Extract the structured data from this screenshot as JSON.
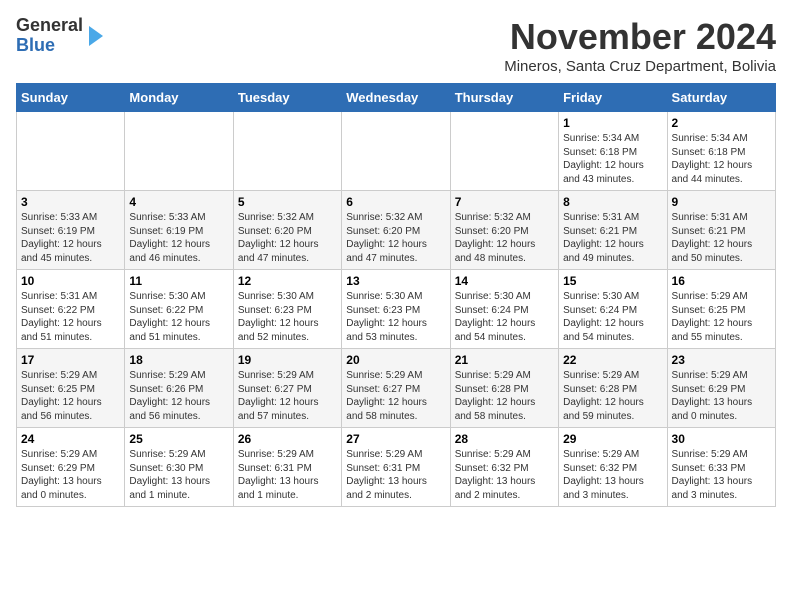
{
  "logo": {
    "general": "General",
    "blue": "Blue"
  },
  "header": {
    "title": "November 2024",
    "subtitle": "Mineros, Santa Cruz Department, Bolivia"
  },
  "days_of_week": [
    "Sunday",
    "Monday",
    "Tuesday",
    "Wednesday",
    "Thursday",
    "Friday",
    "Saturday"
  ],
  "weeks": [
    [
      {
        "day": "",
        "info": ""
      },
      {
        "day": "",
        "info": ""
      },
      {
        "day": "",
        "info": ""
      },
      {
        "day": "",
        "info": ""
      },
      {
        "day": "",
        "info": ""
      },
      {
        "day": "1",
        "info": "Sunrise: 5:34 AM\nSunset: 6:18 PM\nDaylight: 12 hours\nand 43 minutes."
      },
      {
        "day": "2",
        "info": "Sunrise: 5:34 AM\nSunset: 6:18 PM\nDaylight: 12 hours\nand 44 minutes."
      }
    ],
    [
      {
        "day": "3",
        "info": "Sunrise: 5:33 AM\nSunset: 6:19 PM\nDaylight: 12 hours\nand 45 minutes."
      },
      {
        "day": "4",
        "info": "Sunrise: 5:33 AM\nSunset: 6:19 PM\nDaylight: 12 hours\nand 46 minutes."
      },
      {
        "day": "5",
        "info": "Sunrise: 5:32 AM\nSunset: 6:20 PM\nDaylight: 12 hours\nand 47 minutes."
      },
      {
        "day": "6",
        "info": "Sunrise: 5:32 AM\nSunset: 6:20 PM\nDaylight: 12 hours\nand 47 minutes."
      },
      {
        "day": "7",
        "info": "Sunrise: 5:32 AM\nSunset: 6:20 PM\nDaylight: 12 hours\nand 48 minutes."
      },
      {
        "day": "8",
        "info": "Sunrise: 5:31 AM\nSunset: 6:21 PM\nDaylight: 12 hours\nand 49 minutes."
      },
      {
        "day": "9",
        "info": "Sunrise: 5:31 AM\nSunset: 6:21 PM\nDaylight: 12 hours\nand 50 minutes."
      }
    ],
    [
      {
        "day": "10",
        "info": "Sunrise: 5:31 AM\nSunset: 6:22 PM\nDaylight: 12 hours\nand 51 minutes."
      },
      {
        "day": "11",
        "info": "Sunrise: 5:30 AM\nSunset: 6:22 PM\nDaylight: 12 hours\nand 51 minutes."
      },
      {
        "day": "12",
        "info": "Sunrise: 5:30 AM\nSunset: 6:23 PM\nDaylight: 12 hours\nand 52 minutes."
      },
      {
        "day": "13",
        "info": "Sunrise: 5:30 AM\nSunset: 6:23 PM\nDaylight: 12 hours\nand 53 minutes."
      },
      {
        "day": "14",
        "info": "Sunrise: 5:30 AM\nSunset: 6:24 PM\nDaylight: 12 hours\nand 54 minutes."
      },
      {
        "day": "15",
        "info": "Sunrise: 5:30 AM\nSunset: 6:24 PM\nDaylight: 12 hours\nand 54 minutes."
      },
      {
        "day": "16",
        "info": "Sunrise: 5:29 AM\nSunset: 6:25 PM\nDaylight: 12 hours\nand 55 minutes."
      }
    ],
    [
      {
        "day": "17",
        "info": "Sunrise: 5:29 AM\nSunset: 6:25 PM\nDaylight: 12 hours\nand 56 minutes."
      },
      {
        "day": "18",
        "info": "Sunrise: 5:29 AM\nSunset: 6:26 PM\nDaylight: 12 hours\nand 56 minutes."
      },
      {
        "day": "19",
        "info": "Sunrise: 5:29 AM\nSunset: 6:27 PM\nDaylight: 12 hours\nand 57 minutes."
      },
      {
        "day": "20",
        "info": "Sunrise: 5:29 AM\nSunset: 6:27 PM\nDaylight: 12 hours\nand 58 minutes."
      },
      {
        "day": "21",
        "info": "Sunrise: 5:29 AM\nSunset: 6:28 PM\nDaylight: 12 hours\nand 58 minutes."
      },
      {
        "day": "22",
        "info": "Sunrise: 5:29 AM\nSunset: 6:28 PM\nDaylight: 12 hours\nand 59 minutes."
      },
      {
        "day": "23",
        "info": "Sunrise: 5:29 AM\nSunset: 6:29 PM\nDaylight: 13 hours\nand 0 minutes."
      }
    ],
    [
      {
        "day": "24",
        "info": "Sunrise: 5:29 AM\nSunset: 6:29 PM\nDaylight: 13 hours\nand 0 minutes."
      },
      {
        "day": "25",
        "info": "Sunrise: 5:29 AM\nSunset: 6:30 PM\nDaylight: 13 hours\nand 1 minute."
      },
      {
        "day": "26",
        "info": "Sunrise: 5:29 AM\nSunset: 6:31 PM\nDaylight: 13 hours\nand 1 minute."
      },
      {
        "day": "27",
        "info": "Sunrise: 5:29 AM\nSunset: 6:31 PM\nDaylight: 13 hours\nand 2 minutes."
      },
      {
        "day": "28",
        "info": "Sunrise: 5:29 AM\nSunset: 6:32 PM\nDaylight: 13 hours\nand 2 minutes."
      },
      {
        "day": "29",
        "info": "Sunrise: 5:29 AM\nSunset: 6:32 PM\nDaylight: 13 hours\nand 3 minutes."
      },
      {
        "day": "30",
        "info": "Sunrise: 5:29 AM\nSunset: 6:33 PM\nDaylight: 13 hours\nand 3 minutes."
      }
    ]
  ]
}
